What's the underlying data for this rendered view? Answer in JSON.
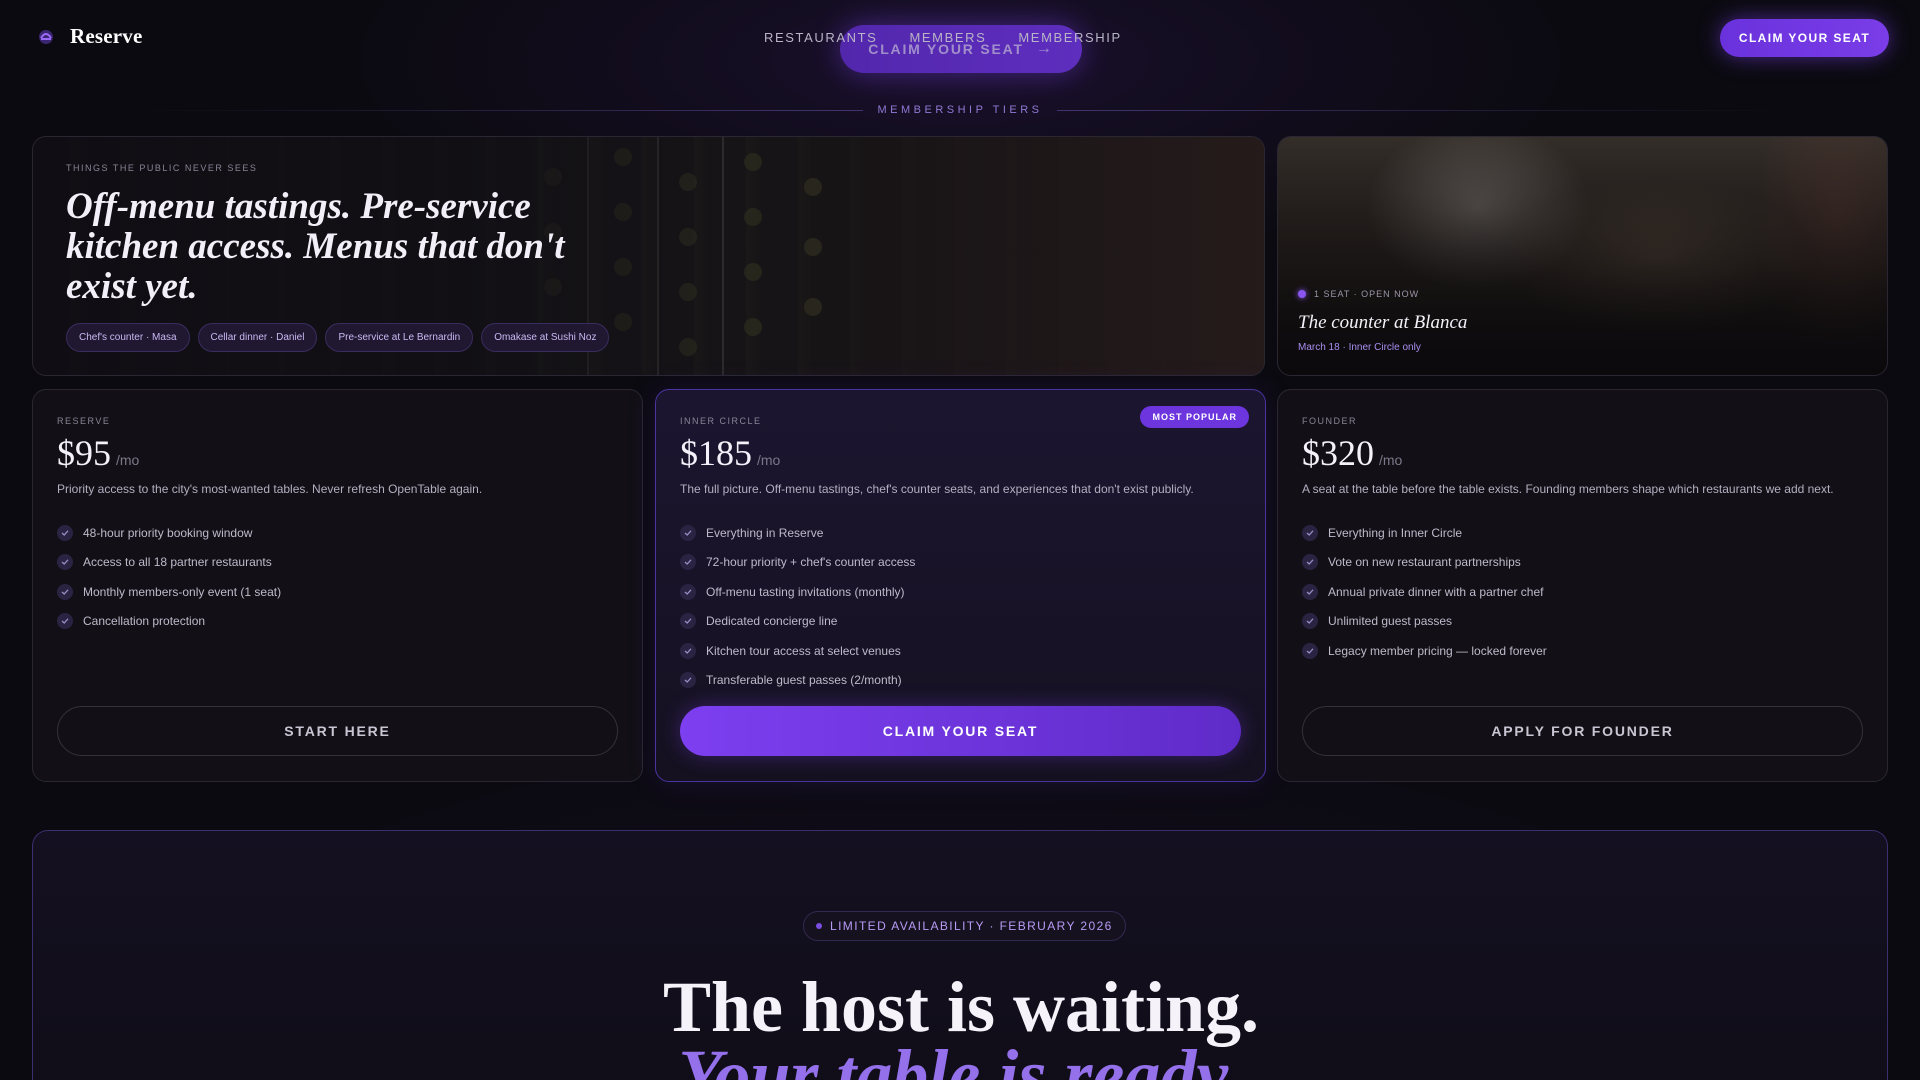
{
  "nav": {
    "brand": "Reserve",
    "links": [
      "RESTAURANTS",
      "MEMBERS",
      "MEMBERSHIP"
    ],
    "floating_cta": "CLAIM YOUR SEAT",
    "cta": "CLAIM YOUR SEAT"
  },
  "section_label": "MEMBERSHIP TIERS",
  "hero": {
    "eyebrow": "THINGS THE PUBLIC NEVER SEES",
    "title": "Off-menu tastings. Pre-service kitchen access. Menus that don't exist yet.",
    "chips": [
      "Chef's counter · Masa",
      "Cellar dinner · Daniel",
      "Pre-service at Le Bernardin",
      "Omakase at Sushi Noz"
    ]
  },
  "side": {
    "status": "1 SEAT · OPEN NOW",
    "title": "The counter at Blanca",
    "sub": "March 18 · Inner Circle only"
  },
  "tiers": [
    {
      "label": "RESERVE",
      "price": "$95",
      "period": "/mo",
      "desc": "Priority access to the city's most-wanted tables. Never refresh OpenTable again.",
      "features": [
        "48-hour priority booking window",
        "Access to all 18 partner restaurants",
        "Monthly members-only event (1 seat)",
        "Cancellation protection"
      ],
      "button": "START HERE"
    },
    {
      "label": "INNER CIRCLE",
      "badge": "MOST POPULAR",
      "price": "$185",
      "period": "/mo",
      "desc": "The full picture. Off-menu tastings, chef's counter seats, and experiences that don't exist publicly.",
      "features": [
        "Everything in Reserve",
        "72-hour priority + chef's counter access",
        "Off-menu tasting invitations (monthly)",
        "Dedicated concierge line",
        "Kitchen tour access at select venues",
        "Transferable guest passes (2/month)"
      ],
      "button": "CLAIM YOUR SEAT"
    },
    {
      "label": "FOUNDER",
      "price": "$320",
      "period": "/mo",
      "desc": "A seat at the table before the table exists. Founding members shape which restaurants we add next.",
      "features": [
        "Everything in Inner Circle",
        "Vote on new restaurant partnerships",
        "Annual private dinner with a partner chef",
        "Unlimited guest passes",
        "Legacy member pricing — locked forever"
      ],
      "button": "APPLY FOR FOUNDER"
    }
  ],
  "cta_section": {
    "availability": "LIMITED AVAILABILITY · FEBRUARY 2026",
    "title": "The host is waiting.",
    "title_2": "Your table is ready."
  },
  "colors": {
    "accent": "#6c35dd",
    "accent_light": "#9470ea",
    "background": "#0b0a10"
  }
}
